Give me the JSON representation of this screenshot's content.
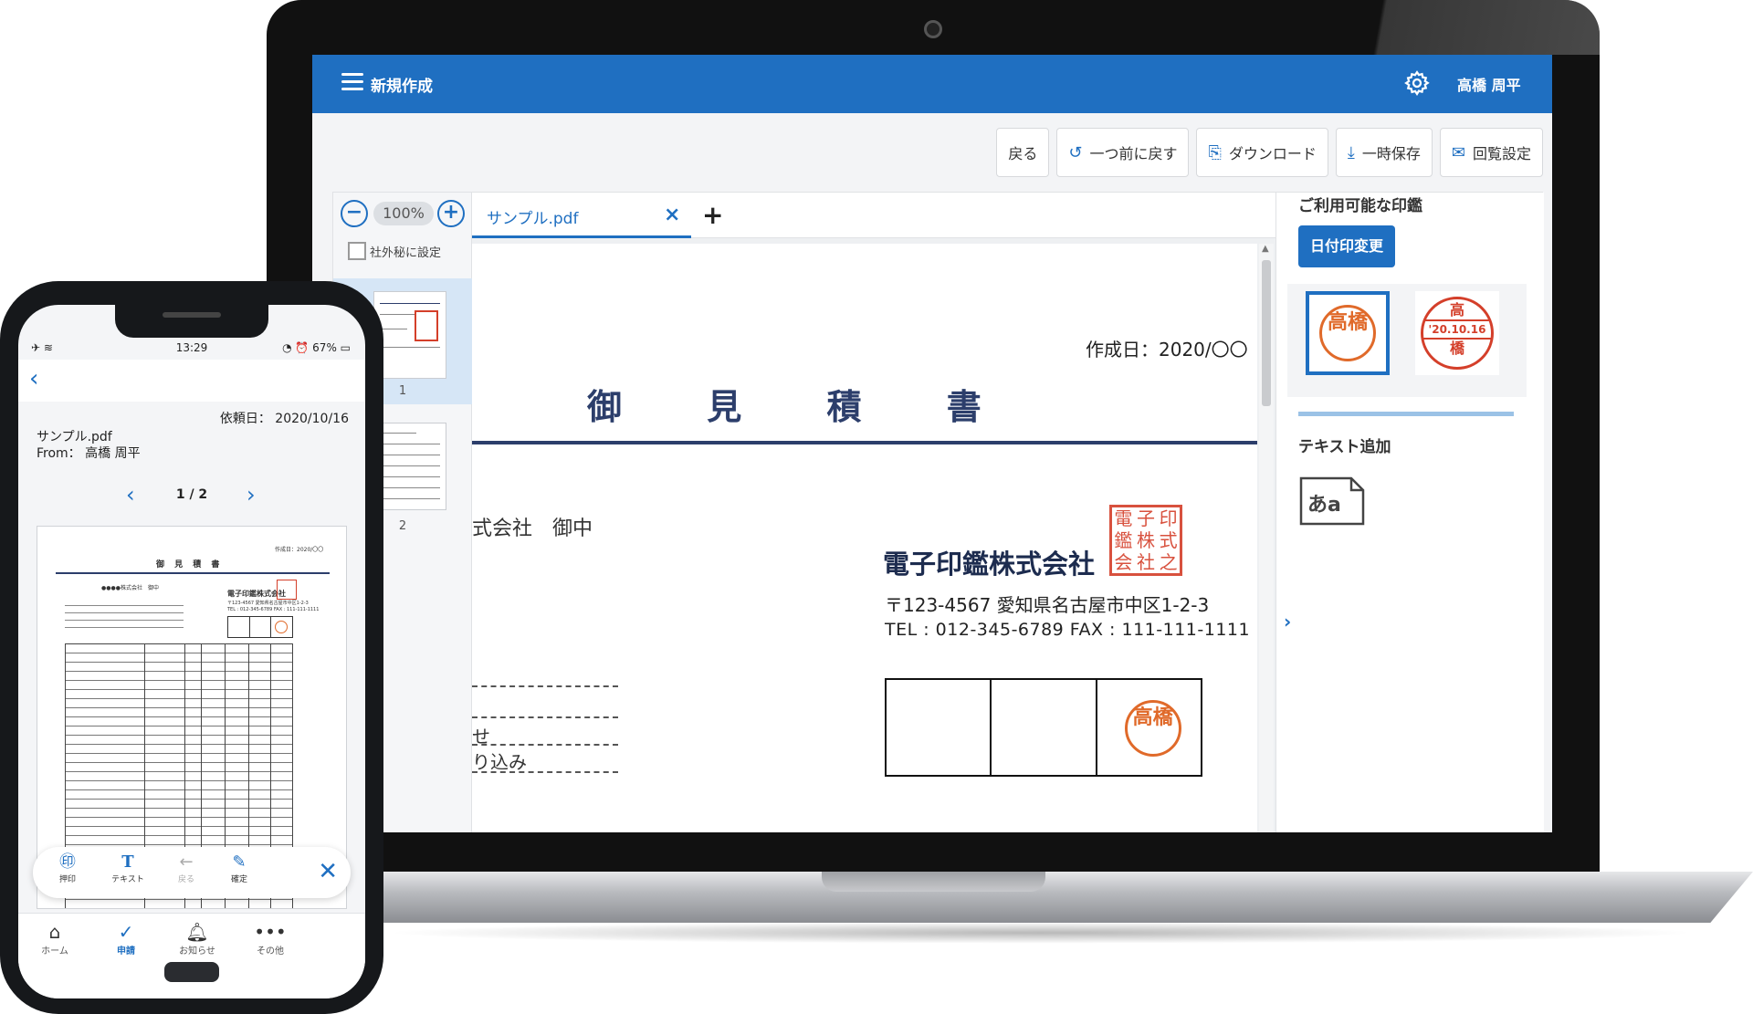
{
  "laptop": {
    "header": {
      "title": "新規作成",
      "user_name": "高橋 周平"
    },
    "toolbar": {
      "back": "戻る",
      "undo": "一つ前に戻す",
      "download": "ダウンロード",
      "save_temp": "一時保存",
      "circulation": "回覧設定"
    },
    "thumbnails": {
      "zoom_minus": "−",
      "zoom_value": "100%",
      "zoom_plus": "+",
      "confidential_label": "社外秘に設定",
      "pages": [
        "1",
        "2"
      ]
    },
    "tab": {
      "file_name": "サンプル.pdf",
      "close": "×",
      "add": "+"
    },
    "document": {
      "created_date": "作成日：2020/〇〇",
      "title": "御 見 積 書",
      "recipient": "式会社　御中",
      "company": "電子印鑑株式会社",
      "company_seal_chars": [
        "電",
        "子",
        "印",
        "鑑",
        "株",
        "式",
        "会",
        "社",
        "之"
      ],
      "address": "〒123-4567 愛知県名古屋市中区1-2-3",
      "tel_fax": "TEL : 012-345-6789 FAX : 111-111-1111",
      "fragment_1": "せ",
      "fragment_2": "り込み",
      "stamp_chars": "高橋"
    },
    "stamp_panel": {
      "title": "ご利用可能な印鑑",
      "date_change_button": "日付印変更",
      "stamp_1": "高橋",
      "stamp_2_top": "高",
      "stamp_2_date": "'20.10.16",
      "stamp_2_bottom": "橋",
      "text_add_title": "テキスト追加",
      "text_add_icon_label": "あa"
    },
    "colors": {
      "primary": "#1f6fc1",
      "seal_red": "#d43f2a",
      "seal_orange": "#e06a2a"
    }
  },
  "phone": {
    "status": {
      "time": "13:29",
      "battery": "67%"
    },
    "request_date": "依頼日： 2020/10/16",
    "file_name": "サンプル.pdf",
    "from": "From： 高橋 周平",
    "pager": "1 / 2",
    "mini_doc": {
      "created": "作成日：2020/〇〇",
      "title": "御 見 積 書",
      "recipient": "●●●●株式会社　御中",
      "company": "電子印鑑株式会社",
      "address": "〒123-4567 愛知県名古屋市中区1-2-3",
      "tel": "TEL : 012-345-6789 FAX : 111-111-1111"
    },
    "tools": {
      "stamp": "押印",
      "text": "テキスト",
      "back": "戻る",
      "confirm": "確定"
    },
    "tabs": {
      "home": "ホーム",
      "request": "申請",
      "notice": "お知らせ",
      "other": "その他"
    }
  }
}
